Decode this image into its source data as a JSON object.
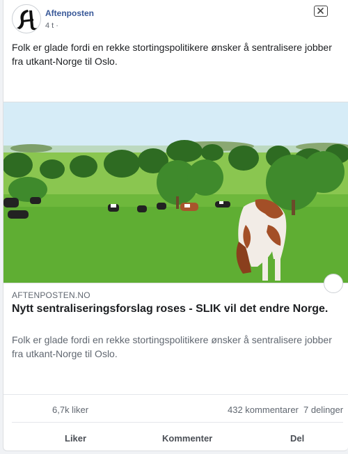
{
  "post": {
    "page_name": "Aftenposten",
    "time": "4 t ·",
    "text": "Folk er glade fordi en rekke stortingspolitikere ønsker å sentralisere jobber fra utkant-Norge til Oslo.",
    "close_icon": "close-icon"
  },
  "link": {
    "domain": "AFTENPOSTEN.NO",
    "headline": "Nytt sentraliseringsforslag roses - SLIK vil det endre Norge.",
    "description": "Folk er glade fordi en rekke stortingspolitikere ønsker å sentralisere jobber fra utkant-Norge til Oslo."
  },
  "stats": {
    "likes": "6,7k liker",
    "comments": "432 kommentarer",
    "shares": "7 delinger"
  },
  "actions": {
    "like": "Liker",
    "comment": "Kommenter",
    "share": "Del"
  },
  "colors": {
    "page_name": "#385898",
    "secondary_text": "#606770",
    "grass": "#6eb83c",
    "sky": "#d6ecf7"
  }
}
